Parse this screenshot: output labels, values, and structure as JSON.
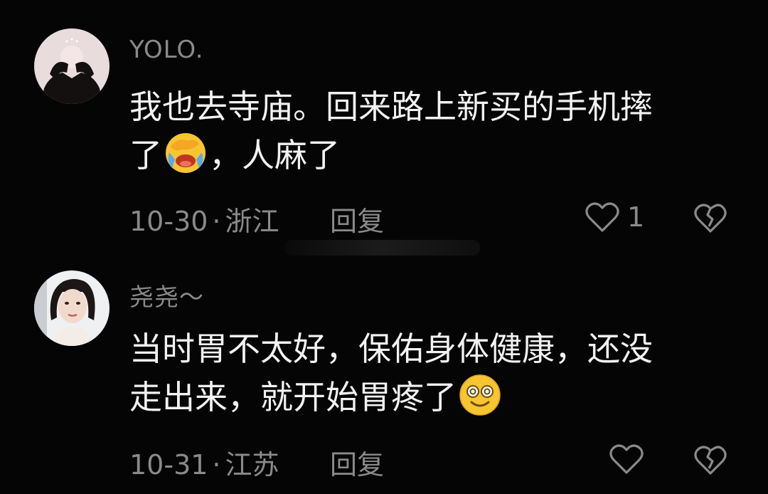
{
  "comments": [
    {
      "username": "YOLO.",
      "text_line1": "我也去寺庙。回来路上新买的手机摔",
      "text_line2_before": "了",
      "text_line2_after": "，人麻了",
      "emoji": "face-with-hand-over-eyes-crying-emoji",
      "date": "10-30",
      "separator": "·",
      "location": "浙江",
      "reply_label": "回复",
      "like_count": "1",
      "avatar": "avatar-person-covering-face",
      "like_icon": "heart-outline-icon",
      "dislike_icon": "broken-heart-icon"
    },
    {
      "username": "尧尧～",
      "text_line1": "当时胃不太好，保佑身体健康，还没",
      "text_line2_before": "走出来，就开始胃疼了",
      "text_line2_after": "",
      "emoji": "dizzy-smile-face-emoji",
      "date": "10-31",
      "separator": "·",
      "location": "江苏",
      "reply_label": "回复",
      "like_count": "",
      "avatar": "avatar-woman-portrait",
      "like_icon": "heart-outline-icon",
      "dislike_icon": "broken-heart-icon"
    }
  ],
  "colors": {
    "background": "#050505",
    "text_primary": "#f2f2f2",
    "text_secondary": "#8a8a8a",
    "emoji_yellow": "#f7c531"
  }
}
